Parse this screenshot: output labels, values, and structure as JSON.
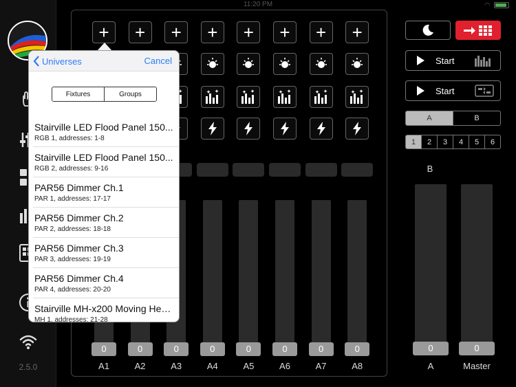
{
  "status_bar": {
    "time": "11:20 PM"
  },
  "sidebar": {
    "version": "2.5.0"
  },
  "channels": [
    {
      "label": "A1",
      "value": "0"
    },
    {
      "label": "A2",
      "value": "0"
    },
    {
      "label": "A3",
      "value": "0"
    },
    {
      "label": "A4",
      "value": "0"
    },
    {
      "label": "A5",
      "value": "0"
    },
    {
      "label": "A6",
      "value": "0"
    },
    {
      "label": "A7",
      "value": "0"
    },
    {
      "label": "A8",
      "value": "0"
    }
  ],
  "right_panel": {
    "start_music_label": "Start",
    "start_chase_label": "Start",
    "ab_options": [
      "A",
      "B"
    ],
    "ab_selected": "A",
    "bank_options": [
      "1",
      "2",
      "3",
      "4",
      "5",
      "6"
    ],
    "bank_selected": "1",
    "crossfade_label": "B",
    "faders": [
      {
        "label": "A",
        "value": "0"
      },
      {
        "label": "Master",
        "value": "0"
      }
    ],
    "accent_color": "#e0202e"
  },
  "popover": {
    "back_label": "Universes",
    "cancel_label": "Cancel",
    "segments": [
      "Fixtures",
      "Groups"
    ],
    "segment_selected": "Fixtures",
    "items": [
      {
        "name": "Stairville LED Flood Panel 150...",
        "sub": "RGB 1, addresses: 1-8"
      },
      {
        "name": "Stairville LED Flood Panel 150...",
        "sub": "RGB 2, addresses: 9-16"
      },
      {
        "name": "PAR56 Dimmer Ch.1",
        "sub": "PAR 1, addresses: 17-17"
      },
      {
        "name": "PAR56 Dimmer Ch.2",
        "sub": "PAR 2, addresses: 18-18"
      },
      {
        "name": "PAR56 Dimmer Ch.3",
        "sub": "PAR 3, addresses: 19-19"
      },
      {
        "name": "PAR56 Dimmer Ch.4",
        "sub": "PAR 4, addresses: 20-20"
      },
      {
        "name": "Stairville MH-x200 Moving Head...",
        "sub": "MH 1, addresses: 21-28"
      }
    ]
  }
}
